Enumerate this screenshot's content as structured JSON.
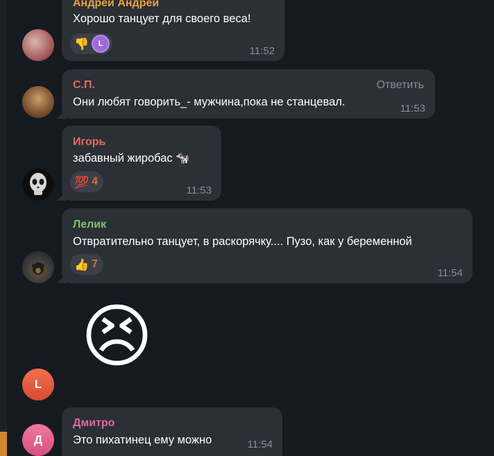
{
  "messages": [
    {
      "sender": "Андрей Андрей",
      "sender_color": "#e8a33c",
      "text": "Хорошо танцует для своего веса!",
      "time": "11:52",
      "reaction": {
        "emoji": "👎",
        "reactor_initial": "L"
      }
    },
    {
      "sender": "С.П.",
      "sender_color": "#e56a5c",
      "reply_label": "Ответить",
      "text": "Они любят говорить_- мужчина,пока не станцевал.",
      "time": "11:53"
    },
    {
      "sender": "Игорь",
      "sender_color": "#e56a5c",
      "text": "забавный жиробас 🐄",
      "time": "11:53",
      "reaction": {
        "emoji": "💯",
        "count": "4"
      }
    },
    {
      "sender": "Лелик",
      "sender_color": "#7ec46a",
      "text": "Отвратительно танцует, в раскорячку.... Пузо, как у беременной",
      "time": "11:54",
      "reaction": {
        "emoji": "👍",
        "count": "7"
      }
    },
    {
      "sticker_emoji": "😣",
      "avatar_initial": "L",
      "avatar_color": "#e0533a"
    },
    {
      "sender": "Дмитро",
      "sender_color": "#e06aa0",
      "text": "Это пихатинец ему можно",
      "time": "11:54",
      "avatar_initial": "Д",
      "avatar_color": "#e05c8a"
    }
  ]
}
